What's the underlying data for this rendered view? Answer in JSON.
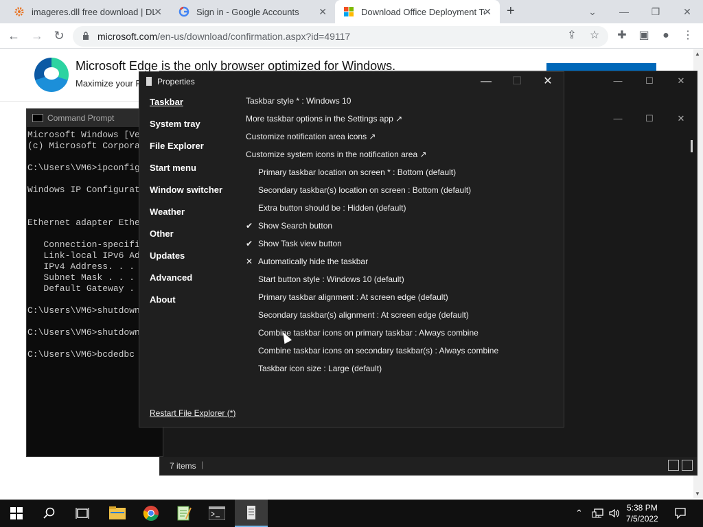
{
  "browser": {
    "tabs": [
      {
        "title": "imageres.dll free download | DLL",
        "icon": "dll-site-icon"
      },
      {
        "title": "Sign in - Google Accounts",
        "icon": "google-icon"
      },
      {
        "title": "Download Office Deployment Too",
        "icon": "microsoft-icon"
      }
    ],
    "new_tab": "+",
    "url_host": "microsoft.com",
    "url_path": "/en-us/download/confirmation.aspx?id=49117"
  },
  "page": {
    "edge_title": "Microsoft Edge is the only browser optimized for Windows.",
    "edge_sub": "Maximize your P"
  },
  "explorer": {
    "status_count": "7 items",
    "status_sep": "|"
  },
  "cmd": {
    "title": "Command Prompt",
    "lines": "Microsoft Windows [Ve\n(c) Microsoft Corpora\n\nC:\\Users\\VM6>ipconfig\n\nWindows IP Configurat\n\n\nEthernet adapter Ethe\n\n   Connection-specifi\n   Link-local IPv6 Ad\n   IPv4 Address. . .\n   Subnet Mask . . .\n   Default Gateway .\n\nC:\\Users\\VM6>shutdown\n\nC:\\Users\\VM6>shutdown\n\nC:\\Users\\VM6>bcdedbc"
  },
  "props": {
    "title": "Properties",
    "nav": [
      "Taskbar",
      "System tray",
      "File Explorer",
      "Start menu",
      "Window switcher",
      "Weather",
      "Other",
      "Updates",
      "Advanced",
      "About"
    ],
    "options": [
      {
        "text": "Taskbar style * : Windows 10",
        "indent": false,
        "mark": ""
      },
      {
        "text": "More taskbar options in the Settings app ↗",
        "indent": false,
        "mark": ""
      },
      {
        "text": "Customize notification area icons ↗",
        "indent": false,
        "mark": ""
      },
      {
        "text": "Customize system icons in the notification area ↗",
        "indent": false,
        "mark": ""
      },
      {
        "text": "Primary taskbar location on screen * : Bottom (default)",
        "indent": true,
        "mark": ""
      },
      {
        "text": "Secondary taskbar(s) location on screen : Bottom (default)",
        "indent": true,
        "mark": ""
      },
      {
        "text": "Extra button should be : Hidden (default)",
        "indent": true,
        "mark": ""
      },
      {
        "text": "Show Search button",
        "indent": true,
        "mark": "✔"
      },
      {
        "text": "Show Task view button",
        "indent": true,
        "mark": "✔"
      },
      {
        "text": "Automatically hide the taskbar",
        "indent": true,
        "mark": "✕"
      },
      {
        "text": "Start button style : Windows 10 (default)",
        "indent": true,
        "mark": ""
      },
      {
        "text": "Primary taskbar alignment : At screen edge (default)",
        "indent": true,
        "mark": ""
      },
      {
        "text": "Secondary taskbar(s) alignment : At screen edge (default)",
        "indent": true,
        "mark": ""
      },
      {
        "text": "Combine taskbar icons on primary taskbar : Always combine",
        "indent": true,
        "mark": ""
      },
      {
        "text": "Combine taskbar icons on secondary taskbar(s) : Always combine",
        "indent": true,
        "mark": ""
      },
      {
        "text": "Taskbar icon size : Large (default)",
        "indent": true,
        "mark": ""
      }
    ],
    "restart": "Restart File Explorer (*)"
  },
  "taskbar": {
    "apps": [
      "windows-start-icon",
      "search-icon",
      "task-view-icon",
      "file-explorer-icon",
      "chrome-icon",
      "notepad-icon",
      "command-prompt-icon",
      "properties-app-icon"
    ],
    "time": "5:38 PM",
    "date": "7/5/2022"
  },
  "colors": {
    "dialog_bg": "#1f1f1f",
    "taskbar_bg": "#101010",
    "accent": "#76b9ed"
  }
}
